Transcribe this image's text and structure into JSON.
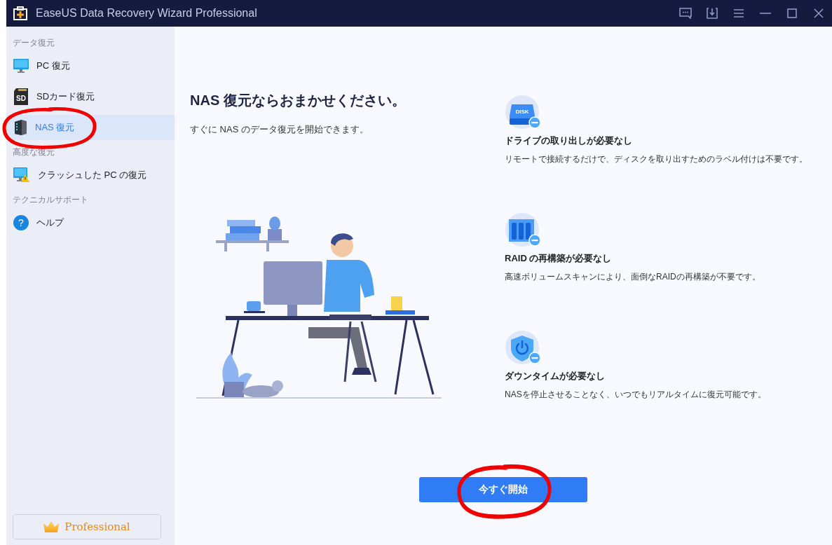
{
  "window": {
    "title": "EaseUS Data Recovery Wizard Professional"
  },
  "sidebar": {
    "sections": [
      {
        "label": "データ復元",
        "items": [
          {
            "label": "PC 復元",
            "kind": "monitor",
            "selected": false,
            "highlighted": false
          },
          {
            "label": "SDカード復元",
            "kind": "sdcard",
            "icon_text": "SD",
            "selected": false,
            "highlighted": false
          },
          {
            "label": "NAS 復元",
            "kind": "nas",
            "selected": true,
            "highlighted": true
          }
        ]
      },
      {
        "label": "高度な復元",
        "items": [
          {
            "label": "クラッシュした PC の復元",
            "kind": "crash",
            "selected": false,
            "highlighted": false
          }
        ]
      },
      {
        "label": "テクニカルサポート",
        "items": [
          {
            "label": "ヘルプ",
            "kind": "help",
            "icon_text": "?",
            "selected": false,
            "highlighted": false
          }
        ]
      }
    ],
    "upgrade_button": "Professional"
  },
  "main": {
    "heading": "NAS 復元ならおまかせください。",
    "subtitle": "すぐに NAS のデータ復元を開始できます。",
    "features": [
      {
        "kind": "disk",
        "icon_text": "DISK",
        "title": "ドライブの取り出しが必要なし",
        "description": "リモートで接続するだけで、ディスクを取り出すためのラベル付けは不要です。"
      },
      {
        "kind": "raid",
        "title": "RAID の再構築が必要なし",
        "description": "高速ボリュームスキャンにより、面倒なRAIDの再構築が不要です。"
      },
      {
        "kind": "power",
        "title": "ダウンタイムが必要なし",
        "description": "NASを停止させることなく、いつでもリアルタイムに復元可能です。"
      }
    ],
    "start_button": {
      "label": "今すぐ開始",
      "highlighted": true
    }
  }
}
